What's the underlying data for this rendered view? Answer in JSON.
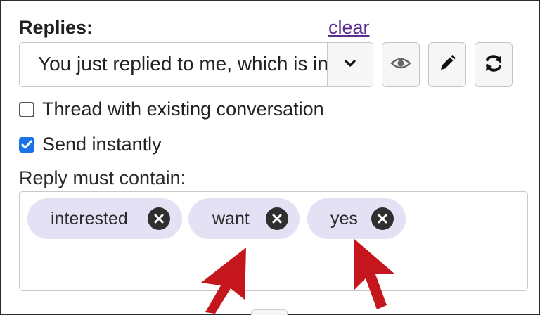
{
  "replies": {
    "label": "Replies:",
    "clear_link": "clear",
    "selected_reply": "You just replied to me, which is interesting"
  },
  "options": {
    "thread_label": "Thread with existing conversation",
    "thread_checked": false,
    "send_label": "Send instantly",
    "send_checked": true
  },
  "must_contain": {
    "label": "Reply must contain:",
    "tags": [
      "interested",
      "want",
      "yes"
    ]
  },
  "icons": {
    "toggle": "chevron-down-icon",
    "preview": "eye-icon",
    "edit": "pencil-icon",
    "refresh": "refresh-icon",
    "remove_tag": "close-circle-icon"
  },
  "colors": {
    "link": "#5b2d8e",
    "tag_background": "#e4e1f5",
    "checkbox_checked": "#1a73e8",
    "annotation_arrow": "#c4161c"
  }
}
